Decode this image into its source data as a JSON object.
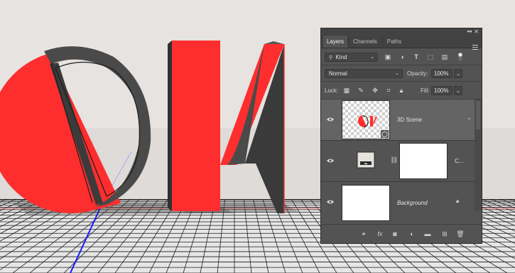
{
  "canvas": {
    "background_color": "#e7e3e0",
    "floor_color": "#e6e6e6",
    "object_color": "#ff2e2e",
    "object_letters": "OK"
  },
  "layers_panel": {
    "tabs": [
      {
        "label": "Layers",
        "active": true
      },
      {
        "label": "Channels",
        "active": false
      },
      {
        "label": "Paths",
        "active": false
      }
    ],
    "filter_kind": "Kind",
    "blend_mode": "Normal",
    "opacity_label": "Opacity:",
    "opacity_value": "100%",
    "lock_label": "Lock:",
    "fill_label": "Fill:",
    "fill_value": "100%",
    "layers": [
      {
        "name": "3D Scene",
        "selected": true
      },
      {
        "name": "C...",
        "selected": false
      },
      {
        "name": "Background",
        "selected": false
      }
    ]
  }
}
